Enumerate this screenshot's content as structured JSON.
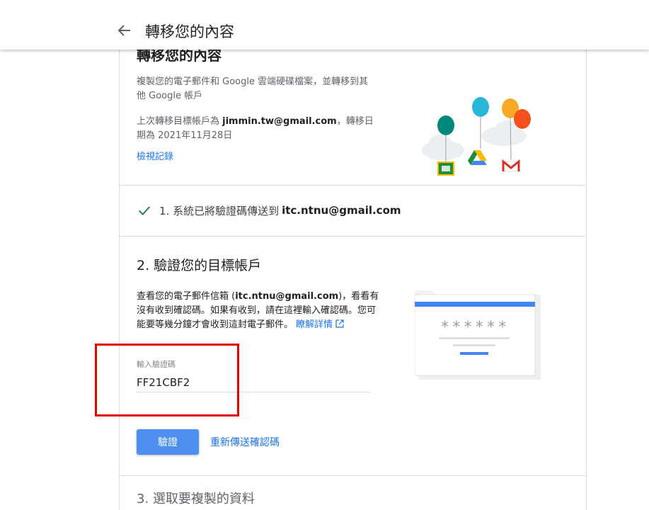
{
  "header": {
    "title": "轉移您的內容",
    "back_icon": "arrow-back-icon"
  },
  "intro": {
    "title": "轉移您的內容",
    "description": "複製您的電子郵件和 Google 雲端硬碟檔案，並轉移到其他 Google 帳戶",
    "last_transfer_prefix": "上次轉移目標帳戶為 ",
    "last_transfer_email": "jimmin.tw@gmail.com",
    "last_transfer_suffix": "，轉移日期為 2021年11月28日",
    "view_log_link": "檢視記錄"
  },
  "step1": {
    "text": "1. 系統已將驗證碼傳送到",
    "email": "itc.ntnu@gmail.com",
    "status_icon": "check-icon"
  },
  "step2": {
    "title": "2. 驗證您的目標帳戶",
    "desc_prefix": "查看您的電子郵件信箱 (",
    "desc_email": "itc.ntnu@gmail.com",
    "desc_suffix": ")，看看有沒有收到確認碼。如果有收到，請在這裡輸入確認碼。您可能要等幾分鐘才會收到這封電子郵件。",
    "learn_more_link": "瞭解詳情",
    "input_label": "輸入驗證碼",
    "input_value": "FF21CBF2",
    "verify_button": "驗證",
    "resend_link": "重新傳送確認碼",
    "masked_code": "******"
  },
  "next_step_partial": "3. 選取要複製的資料",
  "colors": {
    "accent": "#1a73e8",
    "button": "#4d8ff0",
    "check": "#188038",
    "highlight": "#e00000"
  }
}
